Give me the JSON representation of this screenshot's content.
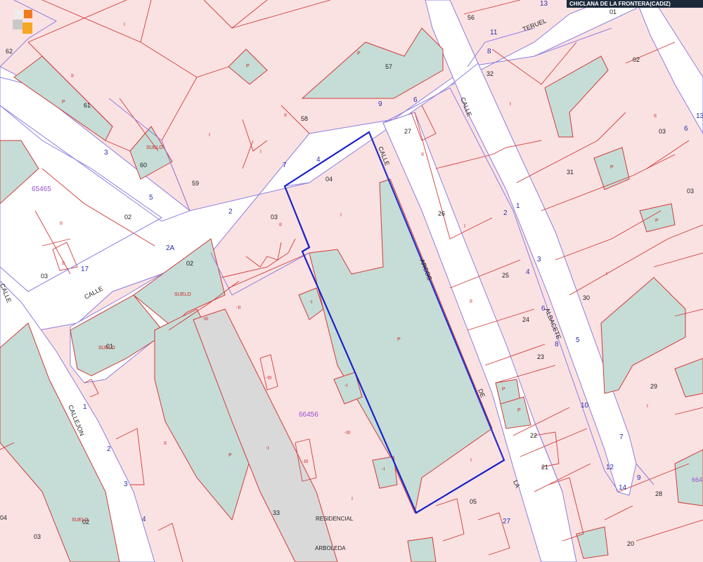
{
  "header": {
    "location": "CHICLANA DE LA FRONTERA(CADIZ)"
  },
  "colors": {
    "urban": "#fbe2e2",
    "green": "#c5ddd6",
    "grey": "#d9d9d9",
    "parcel_line": "#d13b3b",
    "block_line": "#8c7ee0",
    "highlight": "#1a22c8",
    "street_text": "#222",
    "number_text": "#2a2fb0",
    "id_text": "#9b4fd1"
  },
  "icons": {
    "logo": "catastro-logo-icon"
  },
  "streets": [
    {
      "name": "CALLE",
      "key": "calle_1"
    },
    {
      "name": "TERUEL",
      "key": "teruel"
    },
    {
      "name": "CALLE",
      "key": "calle_2"
    },
    {
      "name": "CALLE",
      "key": "calle_3"
    },
    {
      "name": "ARCOS",
      "key": "arcos"
    },
    {
      "name": "DE",
      "key": "de"
    },
    {
      "name": "LA",
      "key": "la"
    },
    {
      "name": "ALBACETE",
      "key": "albacete"
    },
    {
      "name": "CALLEJON",
      "key": "callejon"
    },
    {
      "name": "CALLE",
      "key": "calle_4"
    }
  ],
  "parcels": [
    "56",
    "01",
    "62",
    "57",
    "61",
    "32",
    "02",
    "58",
    "27",
    "60",
    "59",
    "03",
    "31",
    "04",
    "02",
    "03",
    "26",
    "65465",
    "03",
    "02",
    "25",
    "30",
    "24",
    "01",
    "23",
    "29",
    "66456",
    "22",
    "21",
    "28",
    "02",
    "03",
    "33",
    "05",
    "20",
    "04",
    "664"
  ],
  "door_numbers": [
    "13",
    "11",
    "8",
    "9",
    "6",
    "4",
    "7",
    "2",
    "2A",
    "3",
    "5",
    "17",
    "1",
    "2",
    "3",
    "4",
    "1",
    "2",
    "3",
    "4",
    "5",
    "6",
    "7",
    "8",
    "10",
    "12",
    "14",
    "9",
    "27",
    "6",
    "13"
  ],
  "land_use": [
    "I",
    "II",
    "SUELO",
    "SUELO",
    "SUELO",
    "SUELO",
    "P",
    "-I",
    "-II",
    "-III"
  ],
  "street_signs": {
    "residencial": "RESIDENCIAL",
    "arboleda": "ARBOLEDA"
  }
}
